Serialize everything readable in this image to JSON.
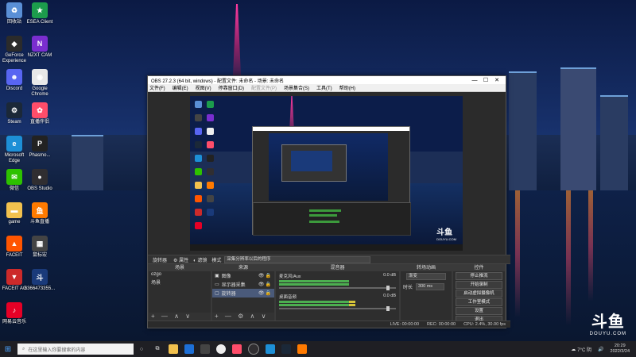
{
  "desktop": {
    "icons": [
      {
        "label": "回收站",
        "icon": "recycle-bin-icon",
        "color": "#5a8fd6",
        "glyph": "♻"
      },
      {
        "label": "ESEA Client",
        "icon": "esea-icon",
        "color": "#1c9c4c",
        "glyph": "★"
      },
      {
        "label": "GeForce Experience",
        "icon": "geforce-icon",
        "color": "#2b2b2b",
        "glyph": "◆"
      },
      {
        "label": "NZXT CAM",
        "icon": "nzxt-icon",
        "color": "#7a2ecf",
        "glyph": "N"
      },
      {
        "label": "Discord",
        "icon": "discord-icon",
        "color": "#5865f2",
        "glyph": "☻"
      },
      {
        "label": "Google Chrome",
        "icon": "chrome-icon",
        "color": "#e8e8e8",
        "glyph": "◉"
      },
      {
        "label": "Steam",
        "icon": "steam-icon",
        "color": "#1b2838",
        "glyph": "⚙"
      },
      {
        "label": "直播伴侣",
        "icon": "live-companion-icon",
        "color": "#ff4d6a",
        "glyph": "✿"
      },
      {
        "label": "Microsoft Edge",
        "icon": "edge-icon",
        "color": "#1d8fd6",
        "glyph": "e"
      },
      {
        "label": "Phasmo...",
        "icon": "phasmophobia-icon",
        "color": "#222222",
        "glyph": "P"
      },
      {
        "label": "微信",
        "icon": "wechat-icon",
        "color": "#2dc100",
        "glyph": "✉"
      },
      {
        "label": "OBS Studio",
        "icon": "obs-icon",
        "color": "#302e31",
        "glyph": "●"
      },
      {
        "label": "game",
        "icon": "folder-icon",
        "color": "#f2c14e",
        "glyph": "▬"
      },
      {
        "label": "斗鱼直播",
        "icon": "douyu-icon",
        "color": "#ff7a00",
        "glyph": "鱼"
      },
      {
        "label": "FACEIT",
        "icon": "faceit-icon",
        "color": "#ff5500",
        "glyph": "▲"
      },
      {
        "label": "鼠标宏",
        "icon": "mouse-macro-icon",
        "color": "#444444",
        "glyph": "▦"
      },
      {
        "label": "FACEIT AC",
        "icon": "faceit-ac-icon",
        "color": "#cc2a2a",
        "glyph": "▼"
      },
      {
        "label": "6366473355...",
        "icon": "douyu-logo-icon",
        "color": "#1a3a7a",
        "glyph": "斗"
      },
      {
        "label": "网易云音乐",
        "icon": "netease-music-icon",
        "color": "#e60026",
        "glyph": "♪"
      }
    ],
    "watermark": {
      "big": "斗鱼",
      "small": "DOUYU.COM"
    }
  },
  "obs": {
    "title": "OBS 27.2.3 (64 bit, windows) - 配置文件: 未命名 - 场景: 未命名",
    "menu": [
      "文件(F)",
      "编辑(E)",
      "视图(V)",
      "停靠窗口(D)",
      "配置文件(P)",
      "场景集合(S)",
      "工具(T)",
      "帮助(H)"
    ],
    "source_bar": {
      "name": "旋转器",
      "props": "属性",
      "filter": "滤镜",
      "mode": "模式",
      "mode_value": "采集分辨率以后的程序"
    },
    "scenes": {
      "title": "场景",
      "items": [
        "ozgo",
        "场景"
      ]
    },
    "sources": {
      "title": "来源",
      "items": [
        {
          "name": "图像",
          "icon": "image-icon"
        },
        {
          "name": "显示器采集",
          "icon": "monitor-icon"
        },
        {
          "name": "旋转器",
          "icon": "window-icon"
        }
      ]
    },
    "mixer": {
      "title": "混音器",
      "channels": [
        {
          "name": "麦克风/Aux",
          "db": "0.0 dB"
        },
        {
          "name": "桌面音频",
          "db": "0.0 dB"
        }
      ]
    },
    "transitions": {
      "title": "转场动画",
      "type": "渐变",
      "duration_label": "时长",
      "duration": "300 ms"
    },
    "controls": {
      "title": "控件",
      "buttons": [
        "停止推流",
        "开始录制",
        "启动虚拟摄像机",
        "工作室模式",
        "设置",
        "退出"
      ]
    },
    "status": {
      "dropped": "LIVE: 00:00:00",
      "rec": "REC: 00:00:00",
      "cpu": "CPU: 2.4%, 30.00 fps"
    }
  },
  "preview": {
    "watermark_big": "斗鱼",
    "watermark_small": "DOUYU.COM"
  },
  "taskbar": {
    "search_placeholder": "在这里输入你要搜索的内容",
    "items": [
      "task-view-icon",
      "explorer-icon",
      "mail-icon",
      "store-icon",
      "chrome-icon",
      "live-icon",
      "obs-icon",
      "edge-icon",
      "steam-icon",
      "douyu-icon"
    ],
    "weather": "7°C 阴",
    "time": "20:29",
    "date": "2022/3/24"
  }
}
